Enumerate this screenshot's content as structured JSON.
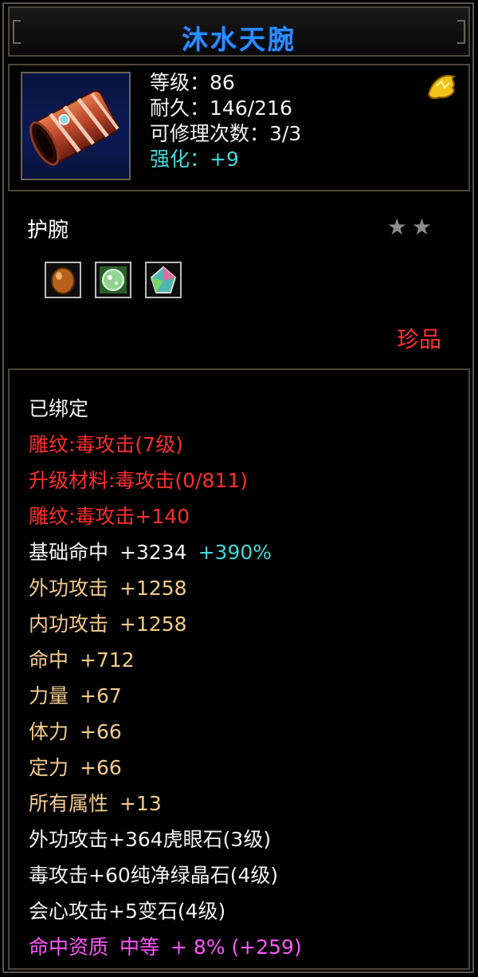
{
  "title": "沐水天腕",
  "info": {
    "level_label": "等级：",
    "level": "86",
    "durability_label": "耐久：",
    "durability": "146/216",
    "repairs_label": "可修理次数：",
    "repairs": "3/3",
    "enhance_label": "强化：",
    "enhance": "+9"
  },
  "item_type": "护腕",
  "stars": "★★",
  "rarity": "珍品",
  "stats": {
    "bound": "已绑定",
    "engrave1": "雕纹:毒攻击(7级)",
    "upgrade_material": "升级材料:毒攻击(0/811)",
    "engrave2": "雕纹:毒攻击+140",
    "base_hit_label": "基础命中",
    "base_hit_value": "+3234",
    "base_hit_pct": "+390%",
    "ext_attack_label": "外功攻击",
    "ext_attack_value": "+1258",
    "int_attack_label": "内功攻击",
    "int_attack_value": "+1258",
    "hit_label": "命中",
    "hit_value": "+712",
    "strength_label": "力量",
    "strength_value": "+67",
    "stamina_label": "体力",
    "stamina_value": "+66",
    "focus_label": "定力",
    "focus_value": "+66",
    "all_attr_label": "所有属性",
    "all_attr_value": "+13",
    "gem1": "外功攻击+364虎眼石(3级)",
    "gem2": "毒攻击+60纯净绿晶石(4级)",
    "gem3": "会心攻击+5变石(4级)",
    "quality_label": "命中资质",
    "quality_grade": "中等",
    "quality_value": "+ 8% (+259)"
  },
  "colors": {
    "title": "#2d8cff",
    "red": "#ff2d2d",
    "tan": "#f3cb8c",
    "cyan": "#43d8d8",
    "pink": "#ff56ff"
  },
  "icons": [
    "bracer-item-icon",
    "gold-dragon-icon",
    "amber-gem-icon",
    "green-jade-gem-icon",
    "rainbow-crystal-gem-icon",
    "star-icon"
  ]
}
